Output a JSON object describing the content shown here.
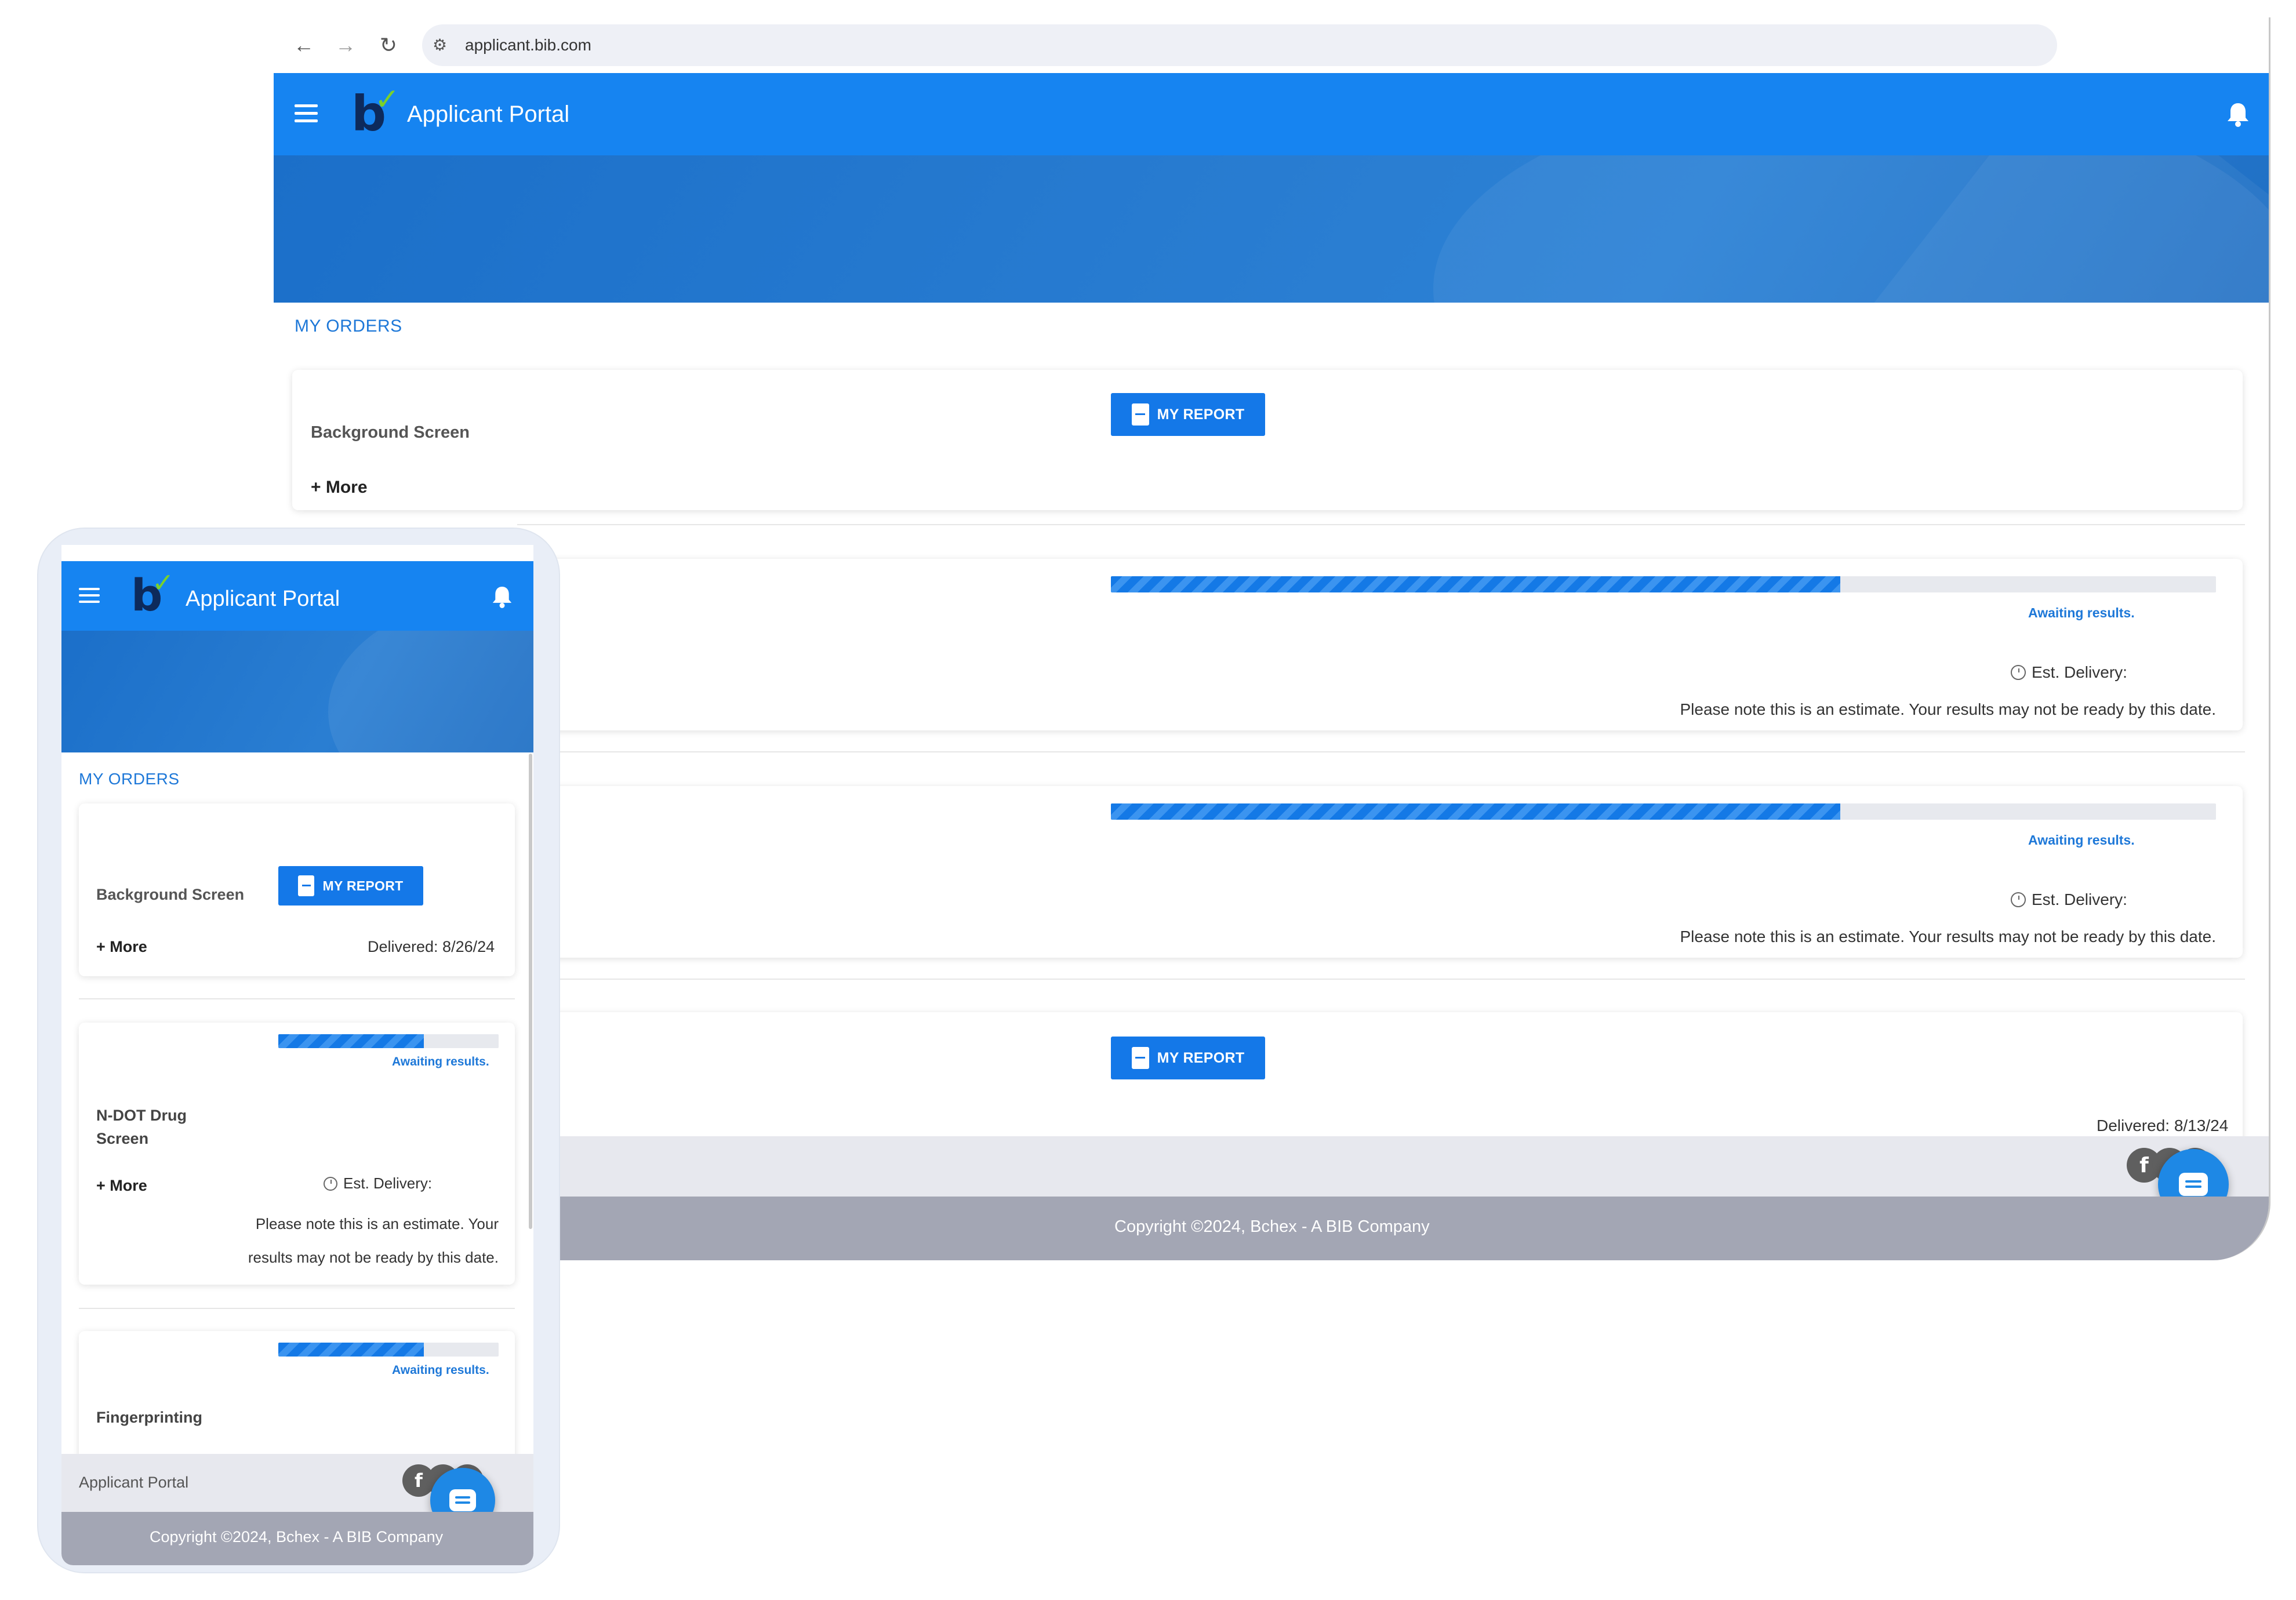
{
  "browser": {
    "url": "applicant.bib.com"
  },
  "app": {
    "title": "Applicant Portal",
    "logo_letter": "b",
    "logo_check": "✓"
  },
  "orders": {
    "section_label": "MY ORDERS",
    "more_label": "+ More",
    "report_button_label": "MY REPORT",
    "awaiting_label": "Awaiting results.",
    "est_delivery_label": "Est. Delivery:",
    "estimate_note": "Please note this is an estimate. Your results may not be ready by this date.",
    "items": [
      {
        "title": "Background Screen",
        "status": "delivered",
        "delivered": "Delivered: 8/26/24"
      },
      {
        "title": "N-DOT Drug Screen",
        "status": "awaiting",
        "progress": 0.66
      },
      {
        "title": "Fingerprinting",
        "status": "awaiting",
        "progress": 0.66
      },
      {
        "title": "",
        "status": "delivered",
        "delivered": "Delivered: 8/13/24"
      }
    ]
  },
  "footer": {
    "portal_label": "Applicant Portal",
    "copyright": "Copyright ©2024, Bchex - A BIB Company",
    "social": [
      "facebook-icon",
      "twitter-icon",
      "linkedin-icon"
    ]
  },
  "icons": {
    "back": "←",
    "forward": "→",
    "reload": "↻",
    "site_settings": "⚙",
    "bell": "🔔",
    "facebook": "f"
  },
  "colors": {
    "header_blue": "#1684f1",
    "button_blue": "#1478e8",
    "label_blue": "#1e78d8",
    "footer_gray": "#a3a6b4",
    "logo_navy": "#0d2a5c",
    "logo_green": "#7ad12c"
  }
}
